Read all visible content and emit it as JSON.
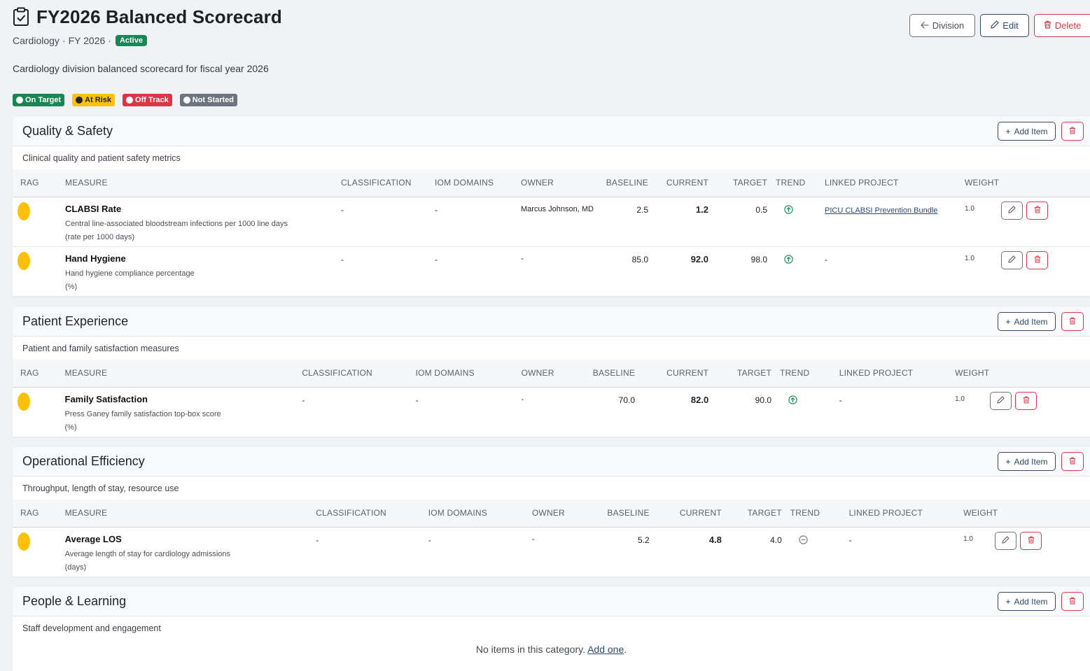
{
  "page": {
    "title": "FY2026 Balanced Scorecard",
    "division": "Cardiology",
    "fiscal_year": "FY 2026",
    "separator": "·",
    "status": "Active",
    "description": "Cardiology division balanced scorecard for fiscal year 2026"
  },
  "actions": {
    "division_label": "Division",
    "edit_label": "Edit",
    "delete_label": "Delete"
  },
  "legend": [
    {
      "label": "On Target",
      "bg": "#198754",
      "dot": "#ffffff",
      "color": "#ffffff"
    },
    {
      "label": "At Risk",
      "bg": "#ffc107",
      "dot": "#212529",
      "color": "#212529"
    },
    {
      "label": "Off Track",
      "bg": "#dc3545",
      "dot": "#ffffff",
      "color": "#ffffff"
    },
    {
      "label": "Not Started",
      "bg": "#6c757d",
      "dot": "#ffffff",
      "color": "#ffffff"
    }
  ],
  "columns": {
    "rag": "RAG",
    "measure": "MEASURE",
    "classification": "CLASSIFICATION",
    "iom_domains": "IOM DOMAINS",
    "owner": "OWNER",
    "baseline": "BASELINE",
    "current": "CURRENT",
    "target": "TARGET",
    "trend": "TREND",
    "linked_project": "LINKED PROJECT",
    "weight": "WEIGHT"
  },
  "section_buttons": {
    "add_item": "Add Item"
  },
  "sections": [
    {
      "title": "Quality & Safety",
      "description": "Clinical quality and patient safety metrics",
      "rows": [
        {
          "rag": "At Risk",
          "name": "CLABSI Rate",
          "desc": "Central line-associated bloodstream infections per 1000 line days",
          "unit": "(rate per 1000 days)",
          "classification": "-",
          "iom": "-",
          "owner": "Marcus Johnson, MD",
          "baseline": "2.5",
          "current": "1.2",
          "target": "0.5",
          "trend": "up",
          "project": "PICU CLABSI Prevention Bundle",
          "weight": "1.0"
        },
        {
          "rag": "At Risk",
          "name": "Hand Hygiene",
          "desc": "Hand hygiene compliance percentage",
          "unit": "(%)",
          "classification": "-",
          "iom": "-",
          "owner": "-",
          "baseline": "85.0",
          "current": "92.0",
          "target": "98.0",
          "trend": "up",
          "project": "-",
          "weight": "1.0"
        }
      ]
    },
    {
      "title": "Patient Experience",
      "description": "Patient and family satisfaction measures",
      "rows": [
        {
          "rag": "At Risk",
          "name": "Family Satisfaction",
          "desc": "Press Ganey family satisfaction top-box score",
          "unit": "(%)",
          "classification": "-",
          "iom": "-",
          "owner": "-",
          "baseline": "70.0",
          "current": "82.0",
          "target": "90.0",
          "trend": "up",
          "project": "-",
          "weight": "1.0"
        }
      ]
    },
    {
      "title": "Operational Efficiency",
      "description": "Throughput, length of stay, resource use",
      "rows": [
        {
          "rag": "At Risk",
          "name": "Average LOS",
          "desc": "Average length of stay for cardiology admissions",
          "unit": "(days)",
          "classification": "-",
          "iom": "-",
          "owner": "-",
          "baseline": "5.2",
          "current": "4.8",
          "target": "4.0",
          "trend": "flat",
          "project": "-",
          "weight": "1.0"
        }
      ]
    },
    {
      "title": "People & Learning",
      "description": "Staff development and engagement",
      "rows": [],
      "empty_text": "No items in this category.",
      "empty_link": "Add one",
      "empty_period": "."
    }
  ],
  "colors": {
    "primary": "#2f4a6d",
    "danger": "#dc3545",
    "success": "#198754",
    "warning": "#ffc107",
    "trend_up": "#198754",
    "trend_flat": "#6c757d"
  },
  "icons": {
    "title": "clipboard-check-icon",
    "division": "arrow-left-icon",
    "edit": "pencil-icon",
    "delete": "trash-icon",
    "add": "plus-icon",
    "trend_up": "arrow-up-circle-icon",
    "trend_flat": "dash-circle-icon"
  }
}
